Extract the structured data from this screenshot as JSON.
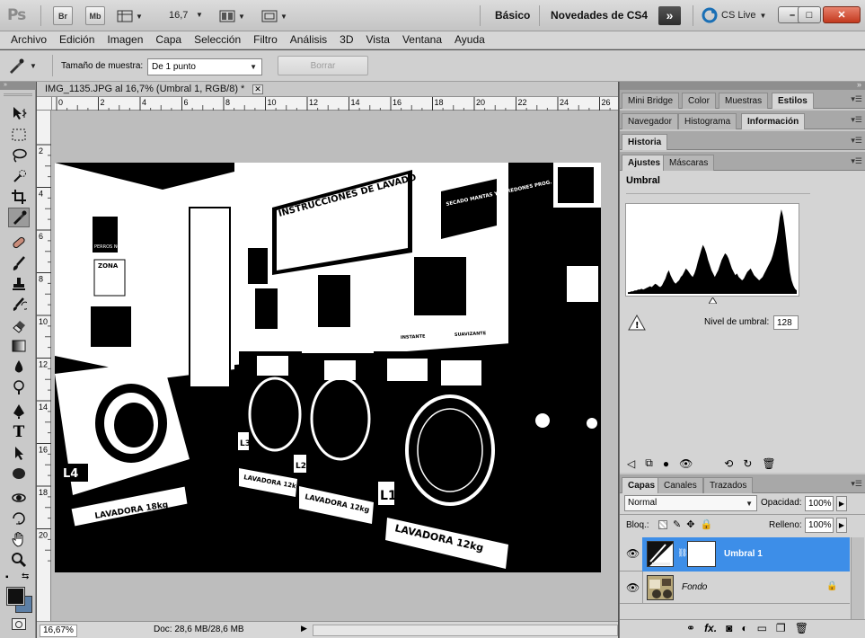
{
  "appbar": {
    "logo": "Ps",
    "bridge_btn": "Br",
    "minibridge_btn": "Mb",
    "zoom_value": "16,7",
    "workspace_basic": "Básico",
    "workspace_new": "Novedades de CS4",
    "more_workspaces": "»",
    "cs_live": "CS Live",
    "window_min": "–",
    "window_max": "□",
    "window_close": "✕"
  },
  "menu": [
    "Archivo",
    "Edición",
    "Imagen",
    "Capa",
    "Selección",
    "Filtro",
    "Análisis",
    "3D",
    "Vista",
    "Ventana",
    "Ayuda"
  ],
  "options": {
    "sample_size_label": "Tamaño de muestra:",
    "sample_size_value": "De 1 punto",
    "clear_btn": "Borrar"
  },
  "document": {
    "tab_title": "IMG_1135.JPG al 16,7% (Umbral 1, RGB/8) *",
    "ruler_h": [
      "0",
      "2",
      "4",
      "6",
      "8",
      "10",
      "12",
      "14",
      "16",
      "18",
      "20",
      "22",
      "24",
      "26"
    ],
    "ruler_v": [
      "2",
      "4",
      "6",
      "8",
      "10",
      "12",
      "14",
      "16",
      "18",
      "20"
    ],
    "status_zoom": "16,67%",
    "status_doc": "Doc: 28,6 MB/28,6 MB",
    "signs": {
      "instructions": "INSTRUCCIONES DE LAVADO",
      "blankets": "SECADO MANTAS Y EDREDONES PROG. 6",
      "zone": "ZONA",
      "dogs": "PERROS NO",
      "washer1": "LAVADORA 18kg",
      "washer2": "LAVADORA 12kg",
      "washer3": "LAVADORA 12kg",
      "washer4": "LAVADORA 12kg",
      "l1": "L1",
      "l2": "L2",
      "l3": "L3",
      "l4": "L4",
      "caption_a": "INSTANTE",
      "caption_b": "SUAVIZANTE"
    }
  },
  "panels": {
    "group1_tabs": [
      "Mini Bridge",
      "Color",
      "Muestras",
      "Estilos"
    ],
    "group2_tabs": [
      "Navegador",
      "Histograma",
      "Información"
    ],
    "group3_tabs": [
      "Historia"
    ],
    "group4_tabs": [
      "Ajustes",
      "Máscaras"
    ],
    "adjust_title": "Umbral",
    "threshold_label": "Nivel de umbral:",
    "threshold_value": "128",
    "layers_tabs": [
      "Capas",
      "Canales",
      "Trazados"
    ],
    "blend_mode": "Normal",
    "opacity_label": "Opacidad:",
    "opacity_value": "100%",
    "lock_label": "Bloq.:",
    "fill_label": "Relleno:",
    "fill_value": "100%",
    "layers": [
      {
        "name": "Umbral 1",
        "selected": true
      },
      {
        "name": "Fondo",
        "selected": false
      }
    ]
  },
  "histogram": [
    2,
    2,
    3,
    3,
    4,
    4,
    5,
    5,
    6,
    5,
    6,
    7,
    8,
    9,
    8,
    10,
    12,
    11,
    9,
    8,
    10,
    14,
    18,
    24,
    28,
    22,
    18,
    14,
    12,
    14,
    16,
    20,
    22,
    26,
    30,
    28,
    25,
    22,
    20,
    24,
    30,
    38,
    45,
    52,
    58,
    54,
    48,
    40,
    34,
    28,
    24,
    20,
    24,
    28,
    34,
    40,
    44,
    48,
    46,
    42,
    36,
    30,
    26,
    22,
    24,
    20,
    18,
    16,
    18,
    22,
    26,
    28,
    30,
    26,
    22,
    20,
    18,
    16,
    18,
    20,
    24,
    28,
    32,
    36,
    40,
    46,
    54,
    62,
    74,
    90,
    100,
    92,
    78,
    60,
    42,
    26,
    16,
    10,
    6,
    4
  ]
}
